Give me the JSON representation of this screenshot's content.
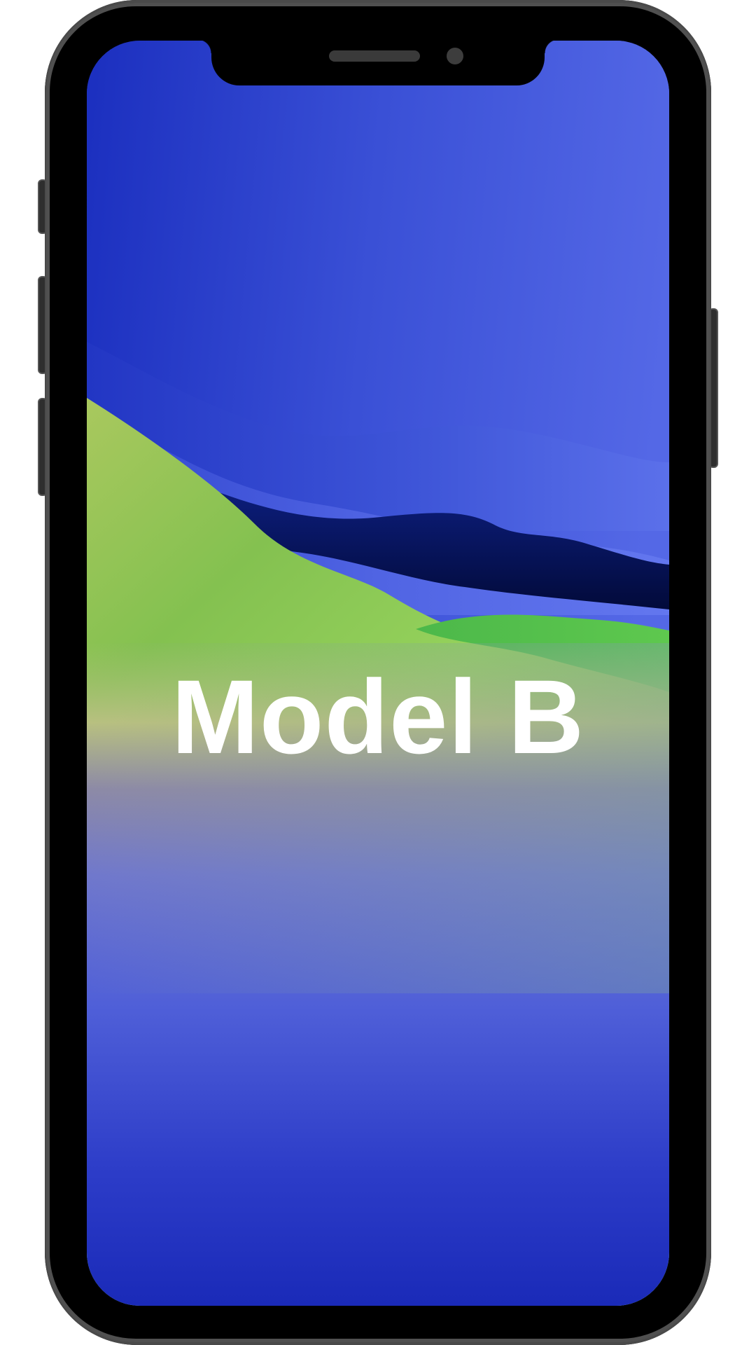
{
  "device": {
    "label": "Model B",
    "frame_color": "#000000",
    "rim_color": "#505050"
  },
  "wallpaper": {
    "name": "blue-green-hills-wallpaper",
    "colors": {
      "sky_deep_blue": "#1b2fbf",
      "sky_light_blue": "#5468e6",
      "hill_green": "#8fd05a",
      "bright_green": "#5ec84e",
      "dark_navy": "#0a1a6e",
      "bottom_blue": "#1a2ab8"
    }
  }
}
